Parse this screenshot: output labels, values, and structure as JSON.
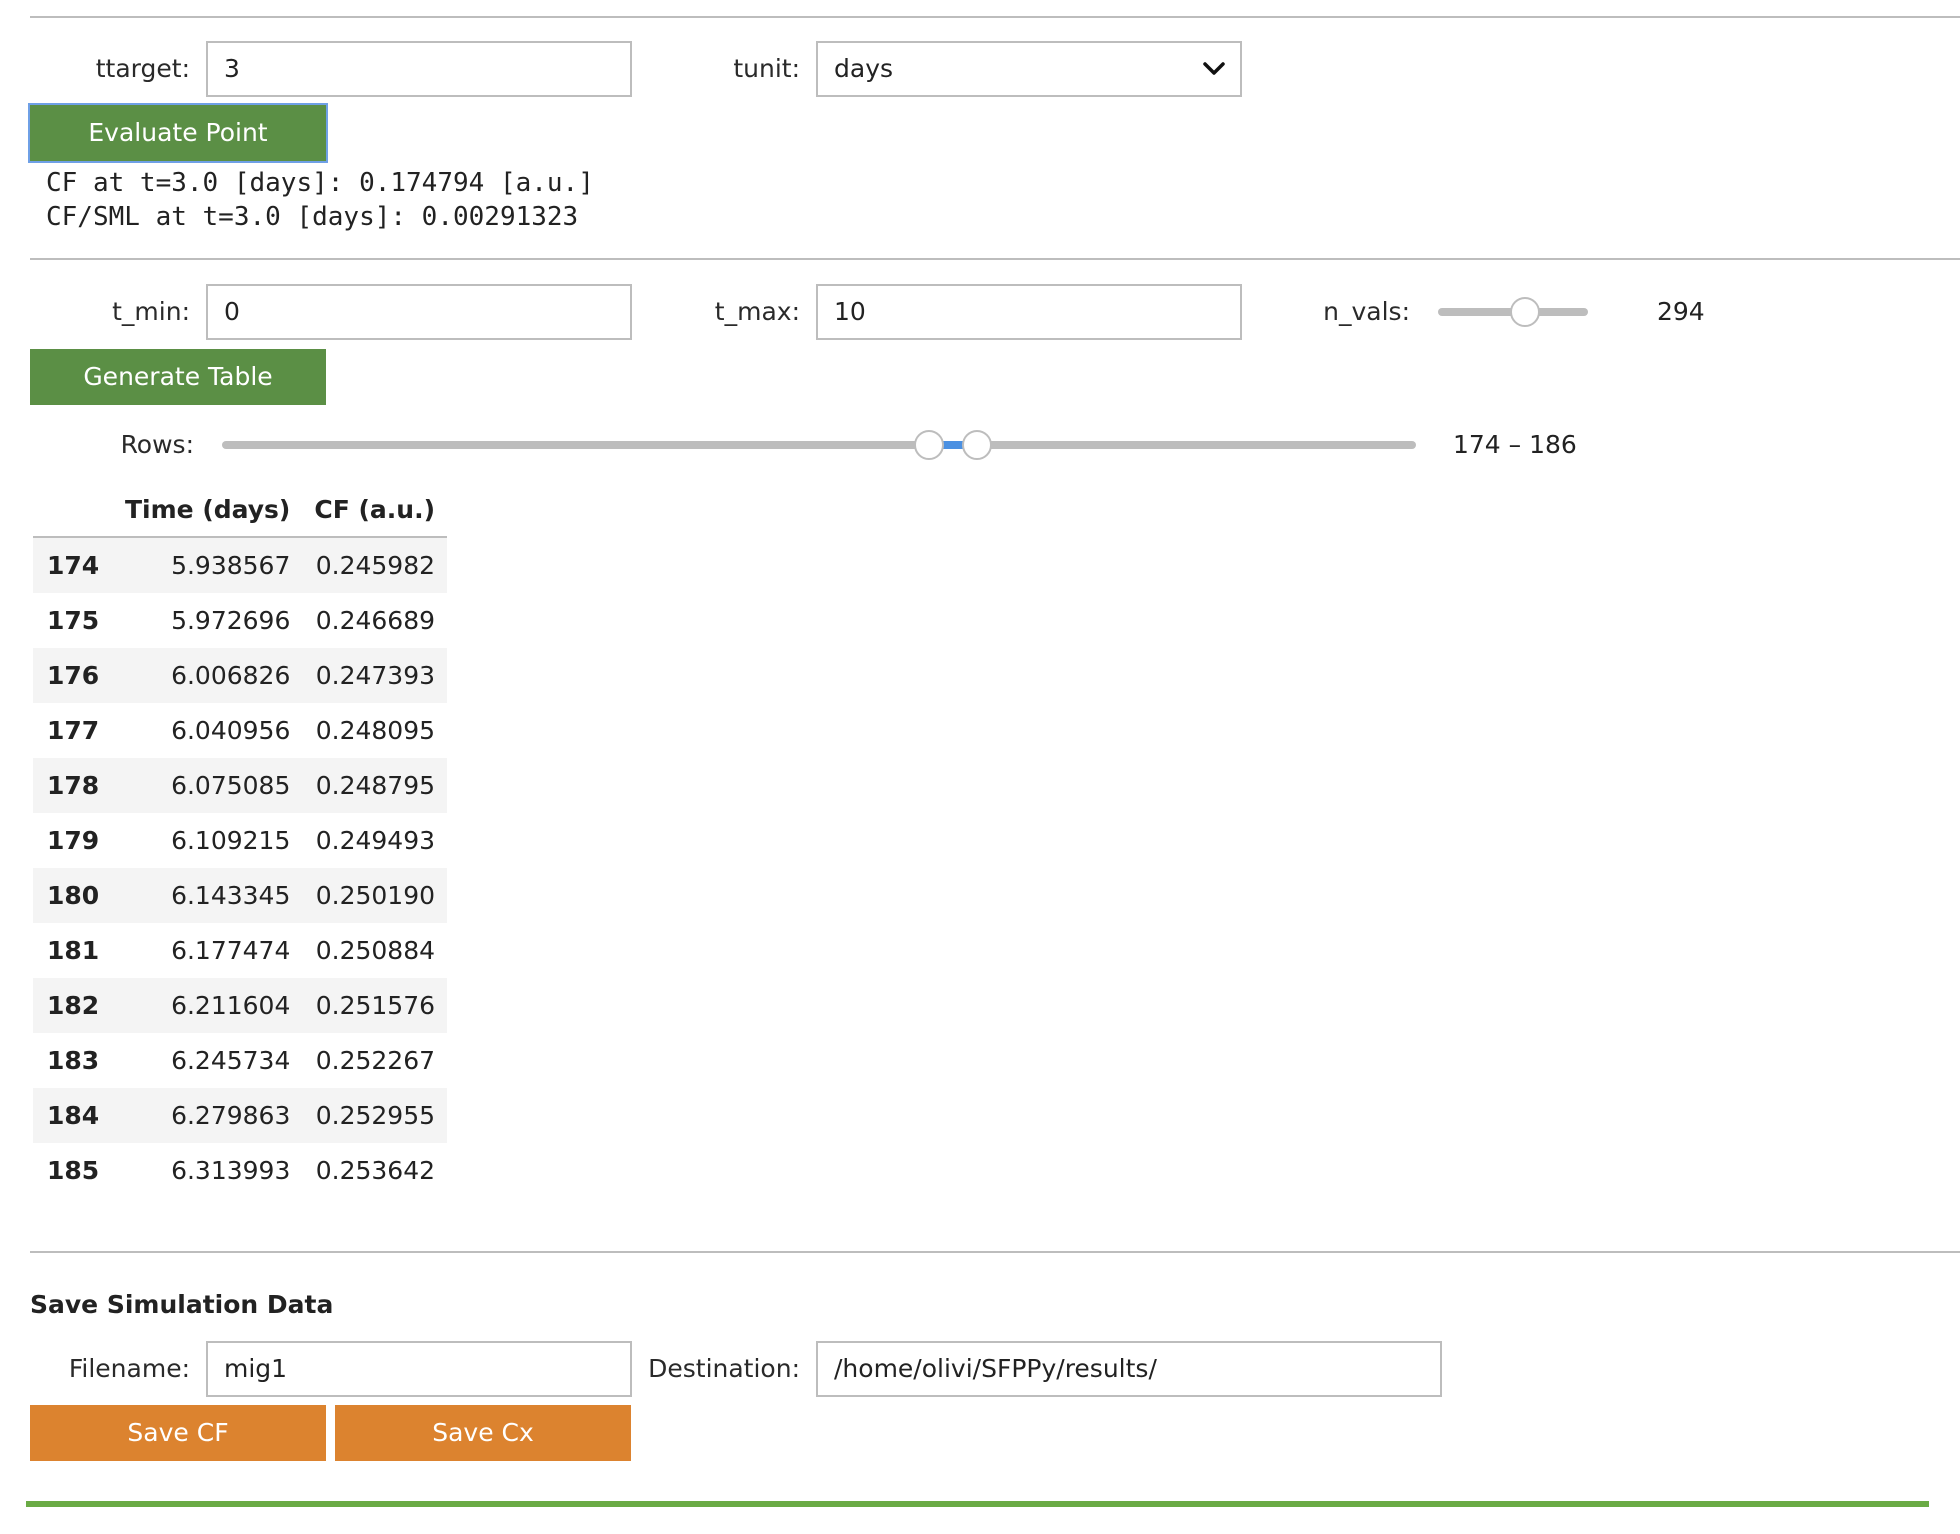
{
  "point_eval": {
    "ttarget_label": "ttarget:",
    "ttarget_value": "3",
    "tunit_label": "tunit:",
    "tunit_value": "days",
    "evaluate_button": "Evaluate Point",
    "result_line1": "CF at t=3.0 [days]: 0.174794 [a.u.]",
    "result_line2": "CF/SML at t=3.0 [days]: 0.00291323"
  },
  "table_gen": {
    "tmin_label": "t_min:",
    "tmin_value": "0",
    "tmax_label": "t_max:",
    "tmax_value": "10",
    "nvals_label": "n_vals:",
    "nvals_value": "294",
    "nvals_fraction": 0.58,
    "generate_button": "Generate Table",
    "rows_label": "Rows:",
    "rows_range_text": "174 – 186",
    "rows_range_low_fraction": 0.592,
    "rows_range_high_fraction": 0.632
  },
  "table": {
    "columns": [
      "",
      "Time (days)",
      "CF (a.u.)"
    ],
    "rows": [
      {
        "idx": "174",
        "time": "5.938567",
        "cf": "0.245982"
      },
      {
        "idx": "175",
        "time": "5.972696",
        "cf": "0.246689"
      },
      {
        "idx": "176",
        "time": "6.006826",
        "cf": "0.247393"
      },
      {
        "idx": "177",
        "time": "6.040956",
        "cf": "0.248095"
      },
      {
        "idx": "178",
        "time": "6.075085",
        "cf": "0.248795"
      },
      {
        "idx": "179",
        "time": "6.109215",
        "cf": "0.249493"
      },
      {
        "idx": "180",
        "time": "6.143345",
        "cf": "0.250190"
      },
      {
        "idx": "181",
        "time": "6.177474",
        "cf": "0.250884"
      },
      {
        "idx": "182",
        "time": "6.211604",
        "cf": "0.251576"
      },
      {
        "idx": "183",
        "time": "6.245734",
        "cf": "0.252267"
      },
      {
        "idx": "184",
        "time": "6.279863",
        "cf": "0.252955"
      },
      {
        "idx": "185",
        "time": "6.313993",
        "cf": "0.253642"
      }
    ]
  },
  "save": {
    "title": "Save Simulation Data",
    "filename_label": "Filename:",
    "filename_value": "mig1",
    "destination_label": "Destination:",
    "destination_value": "/home/olivi/SFPPy/results/",
    "save_cf_button": "Save CF",
    "save_cx_button": "Save Cx"
  },
  "colors": {
    "green_button": "#5b8f45",
    "orange_button": "#dc832f",
    "slider_accent": "#4a90e2",
    "bottom_bar": "#6aab45"
  }
}
